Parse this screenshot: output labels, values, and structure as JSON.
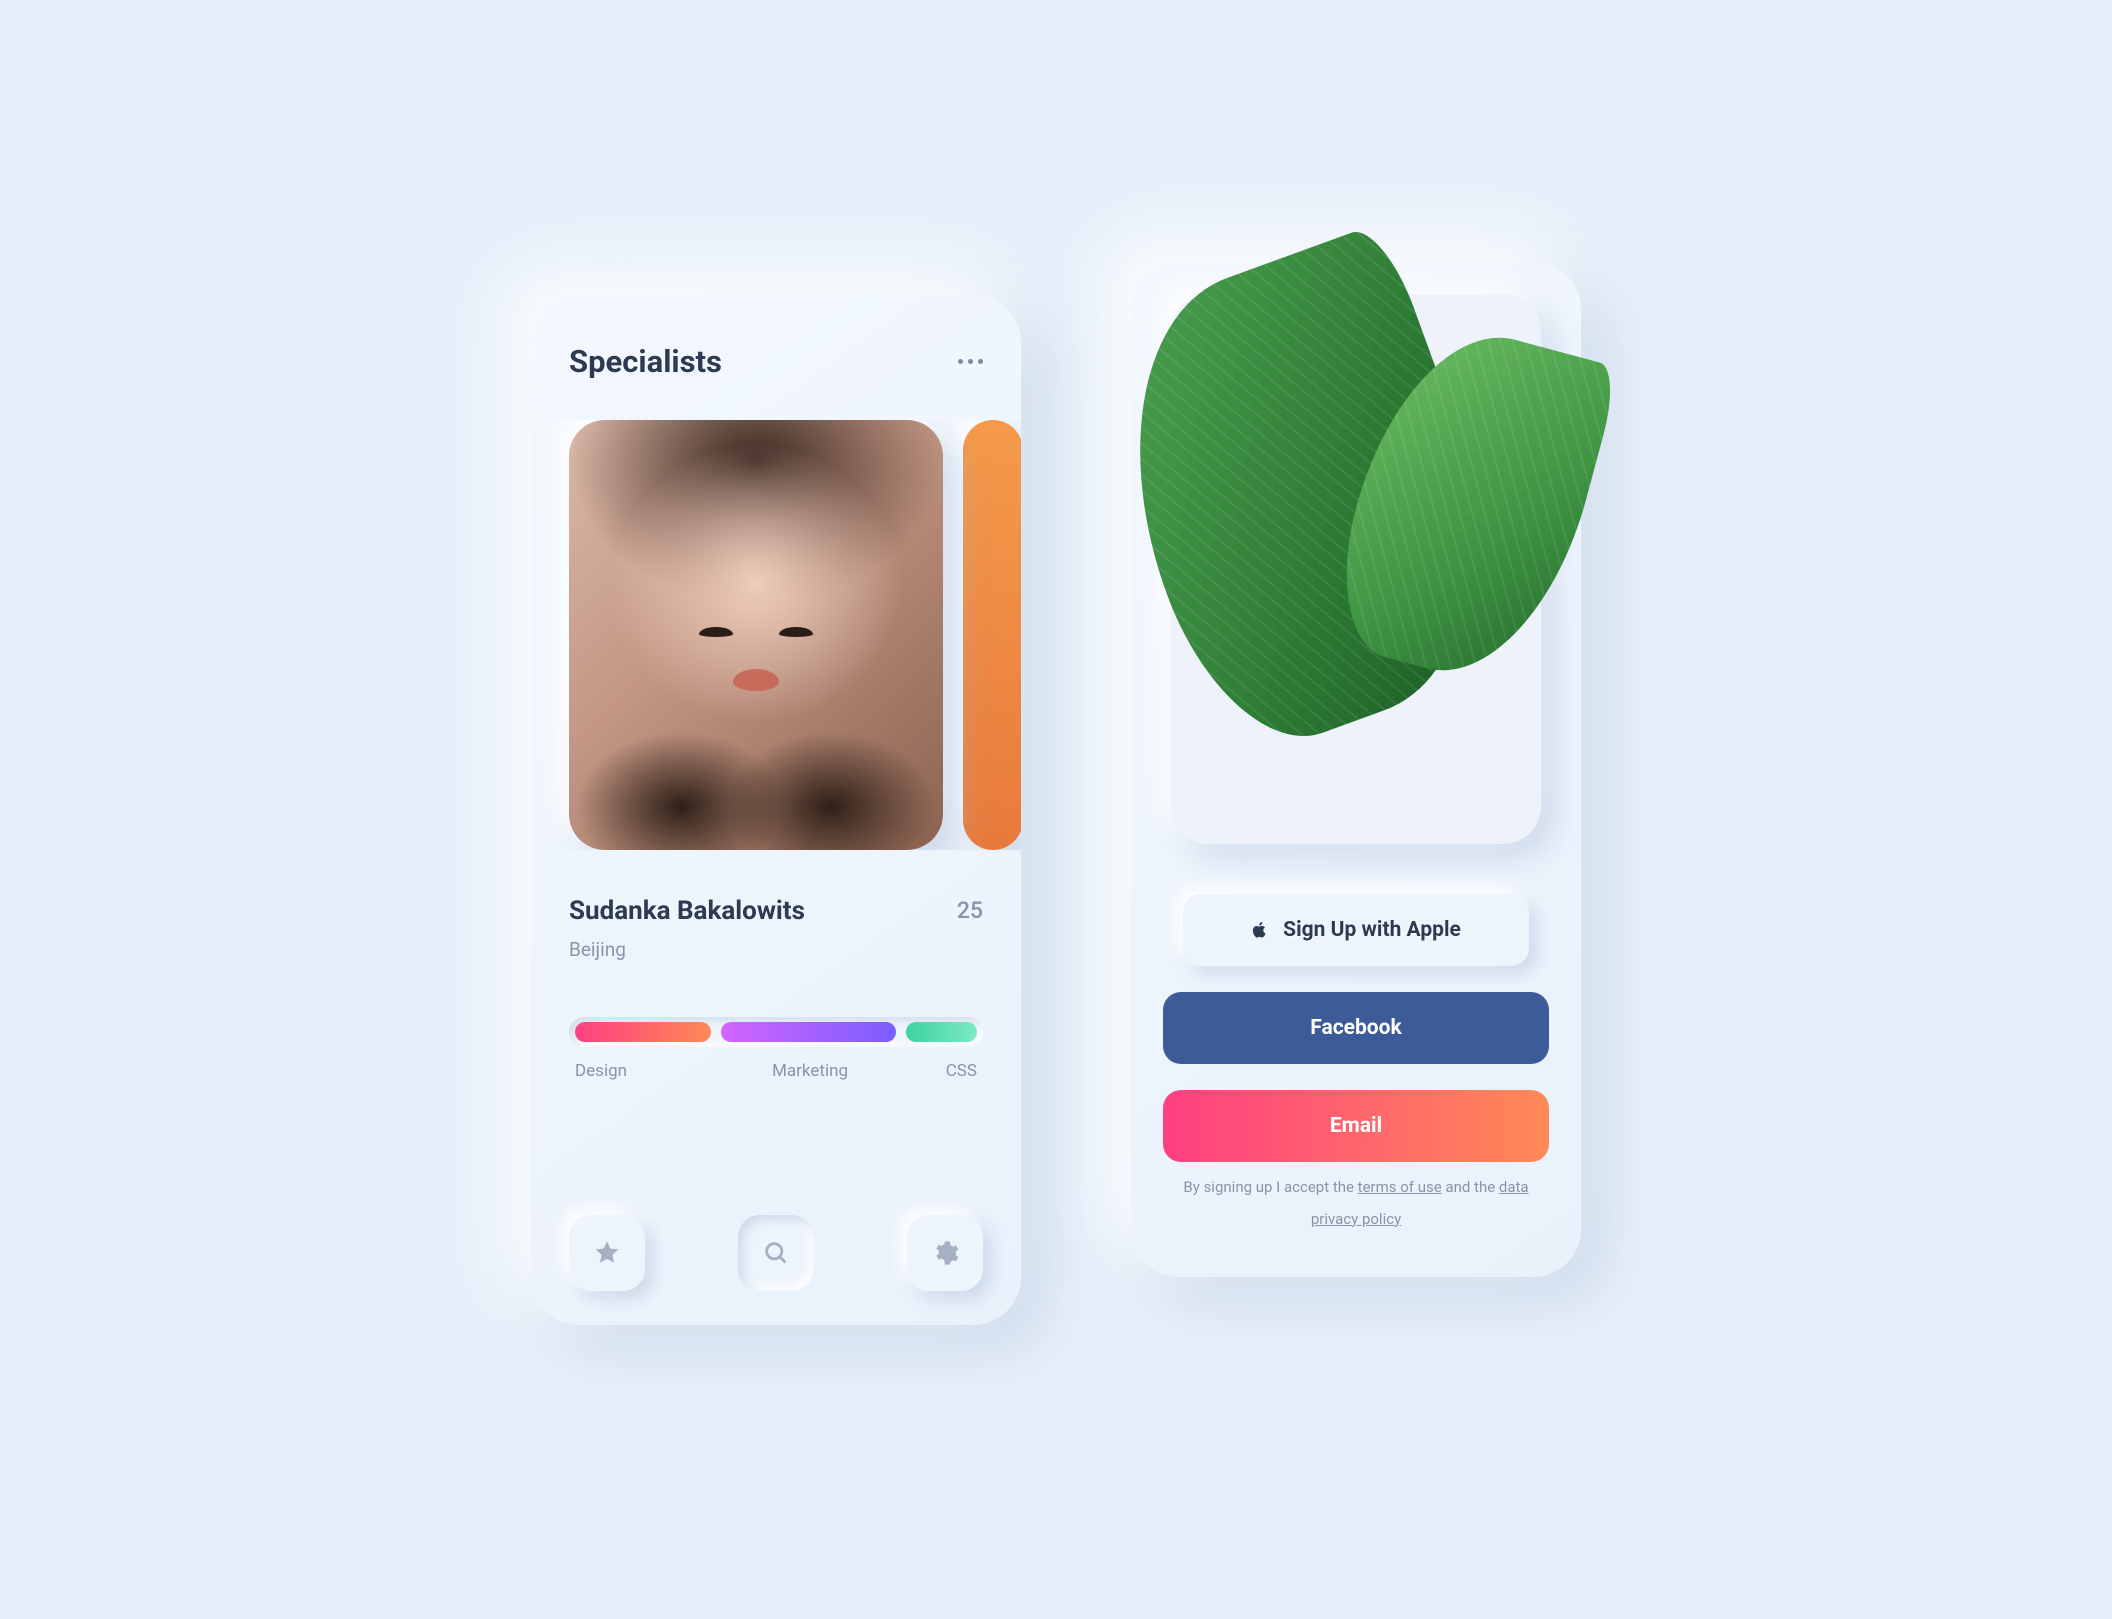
{
  "specialists": {
    "title": "Specialists",
    "person": {
      "name": "Sudanka Bakalowits",
      "age": "25",
      "location": "Beijing"
    },
    "tags": [
      "Design",
      "Marketing",
      "CSS"
    ],
    "nav_icons": [
      "star-icon",
      "search-icon",
      "gear-icon"
    ]
  },
  "signup": {
    "apple": "Sign Up with Apple",
    "facebook": "Facebook",
    "email": "Email",
    "legal_pre": "By signing up I accept the ",
    "link1": "terms of use",
    "legal_mid": " and the ",
    "link2": "data privacy policy"
  },
  "colors": {
    "accent_pink": "#ff3f82",
    "accent_orange": "#ff8a56",
    "accent_purple": "#7c5dff",
    "accent_green": "#3bd3a2",
    "facebook": "#3d5a99"
  }
}
